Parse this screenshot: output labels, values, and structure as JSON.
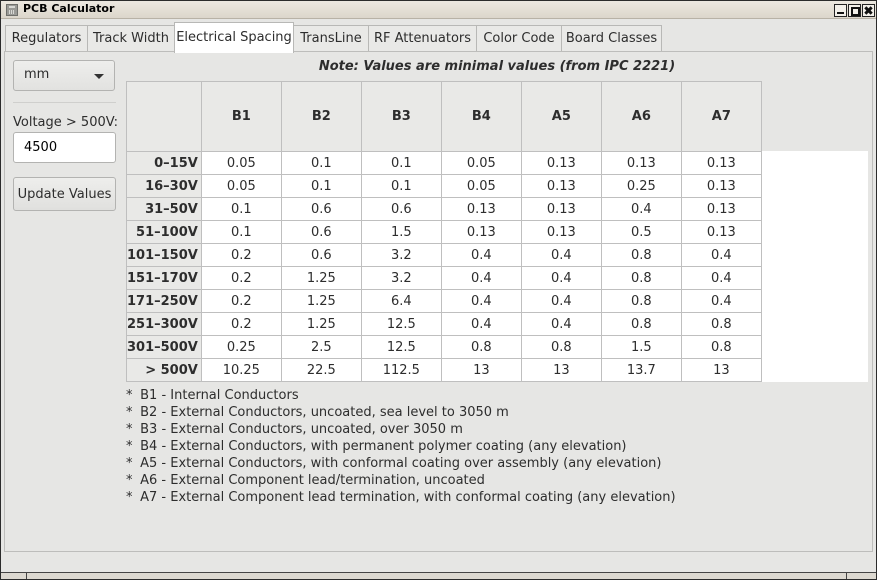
{
  "window": {
    "title": "PCB Calculator",
    "icon": "calculator-icon",
    "controls": [
      "minimize-icon",
      "maximize-icon",
      "close-icon"
    ]
  },
  "tabs": [
    {
      "label": "Regulators",
      "active": false
    },
    {
      "label": "Track Width",
      "active": false
    },
    {
      "label": "Electrical Spacing",
      "active": true
    },
    {
      "label": "TransLine",
      "active": false
    },
    {
      "label": "RF Attenuators",
      "active": false
    },
    {
      "label": "Color Code",
      "active": false
    },
    {
      "label": "Board Classes",
      "active": false
    }
  ],
  "sidebar": {
    "unit_select": "mm",
    "voltage_label": "Voltage > 500V:",
    "voltage_value": "4500",
    "update_button": "Update Values"
  },
  "note": "Note: Values are minimal values (from IPC 2221)",
  "table": {
    "columns": [
      "B1",
      "B2",
      "B3",
      "B4",
      "A5",
      "A6",
      "A7"
    ],
    "rows": [
      {
        "label": "0–15V",
        "values": [
          "0.05",
          "0.1",
          "0.1",
          "0.05",
          "0.13",
          "0.13",
          "0.13"
        ]
      },
      {
        "label": "16–30V",
        "values": [
          "0.05",
          "0.1",
          "0.1",
          "0.05",
          "0.13",
          "0.25",
          "0.13"
        ]
      },
      {
        "label": "31–50V",
        "values": [
          "0.1",
          "0.6",
          "0.6",
          "0.13",
          "0.13",
          "0.4",
          "0.13"
        ]
      },
      {
        "label": "51–100V",
        "values": [
          "0.1",
          "0.6",
          "1.5",
          "0.13",
          "0.13",
          "0.5",
          "0.13"
        ]
      },
      {
        "label": "101–150V",
        "values": [
          "0.2",
          "0.6",
          "3.2",
          "0.4",
          "0.4",
          "0.8",
          "0.4"
        ]
      },
      {
        "label": "151–170V",
        "values": [
          "0.2",
          "1.25",
          "3.2",
          "0.4",
          "0.4",
          "0.8",
          "0.4"
        ]
      },
      {
        "label": "171–250V",
        "values": [
          "0.2",
          "1.25",
          "6.4",
          "0.4",
          "0.4",
          "0.8",
          "0.4"
        ]
      },
      {
        "label": "251–300V",
        "values": [
          "0.2",
          "1.25",
          "12.5",
          "0.4",
          "0.4",
          "0.8",
          "0.8"
        ]
      },
      {
        "label": "301–500V",
        "values": [
          "0.25",
          "2.5",
          "12.5",
          "0.8",
          "0.8",
          "1.5",
          "0.8"
        ]
      },
      {
        "label": "> 500V",
        "values": [
          "10.25",
          "22.5",
          "112.5",
          "13",
          "13",
          "13.7",
          "13"
        ]
      }
    ]
  },
  "legend": [
    "B1 - Internal Conductors",
    "B2 - External Conductors, uncoated, sea level to 3050 m",
    "B3 - External Conductors, uncoated, over 3050 m",
    "B4 - External Conductors, with permanent polymer coating (any elevation)",
    "A5 - External Conductors, with conformal coating over assembly (any elevation)",
    "A6 - External Component lead/termination, uncoated",
    "A7 - External Component lead termination, with conformal coating (any elevation)"
  ],
  "legend_bullet": "*"
}
